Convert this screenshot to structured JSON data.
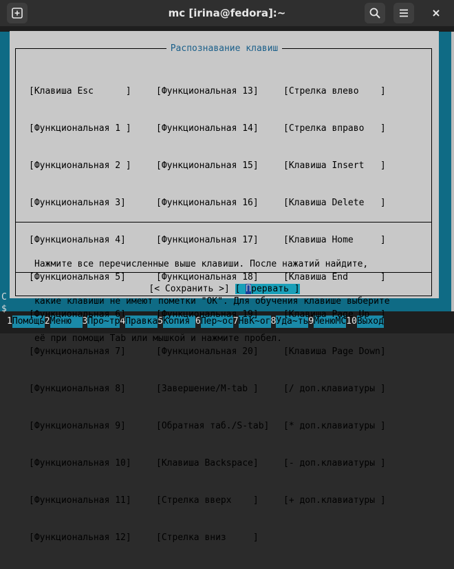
{
  "window": {
    "title": "mc [irina@fedora]:~",
    "new_tab_icon": "plus-square-icon",
    "search_icon": "search-icon",
    "menu_icon": "hamburger-icon",
    "close_icon": "close-icon"
  },
  "dialog": {
    "title": "Распознавание клавиш",
    "columns": [
      [
        "[Клавиша Esc      ]",
        "[Функциональная 1 ]",
        "[Функциональная 2 ]",
        "[Функциональная 3]",
        "[Функциональная 4]",
        "[Функциональная 5]",
        "[Функциональная 6]",
        "[Функциональная 7]",
        "[Функциональная 8]",
        "[Функциональная 9]",
        "[Функциональная 10]",
        "[Функциональная 11]",
        "[Функциональная 12]"
      ],
      [
        "[Функциональная 13]",
        "[Функциональная 14]",
        "[Функциональная 15]",
        "[Функциональная 16]",
        "[Функциональная 17]",
        "[Функциональная 18]",
        "[Функциональная 19]",
        "[Функциональная 20]",
        "[Завершение/M-tab ]",
        "[Обратная таб./S-tab]",
        "[Клавиша Backspace]",
        "[Стрелка вверх    ]",
        "[Стрелка вниз     ]"
      ],
      [
        "[Стрелка влево    ]",
        "[Стрелка вправо   ]",
        "[Клавиша Insert   ]",
        "[Клавиша Delete   ]",
        "[Клавиша Home     ]",
        "[Клавиша End      ]",
        "[Клавиша Page Up  ]",
        "[Клавиша Page Down]",
        "[/ доп.клавиатуры ]",
        "[* доп.клавиатуры ]",
        "[- доп.клавиатуры ]",
        "[+ доп.клавиатуры ]"
      ]
    ],
    "message": [
      "Нажмите все перечисленные выше клавиши. После нажатий найдите,",
      "какие клавиши не имеют пометки \"OK\". Для обучения клавише выберите",
      "её при помощи Tab или мышкой и нажмите пробел."
    ],
    "save_label": "[< Сохранить >]",
    "abort_prefix": "[ ",
    "abort_cursor": "П",
    "abort_rest": "рервать ]"
  },
  "left_edge": [
    "С",
    "$"
  ],
  "fkeys": [
    {
      "num": "1",
      "label": "Помощь"
    },
    {
      "num": "2",
      "label": "Меню  "
    },
    {
      "num": "3",
      "label": "Про~тр"
    },
    {
      "num": "4",
      "label": "Правка"
    },
    {
      "num": "5",
      "label": "Копия "
    },
    {
      "num": "6",
      "label": "Пер~ос"
    },
    {
      "num": "7",
      "label": "НвК~ог"
    },
    {
      "num": "8",
      "label": "Уда~ть"
    },
    {
      "num": "9",
      "label": "МенюМС"
    },
    {
      "num": "10",
      "label": "Выход"
    }
  ]
}
